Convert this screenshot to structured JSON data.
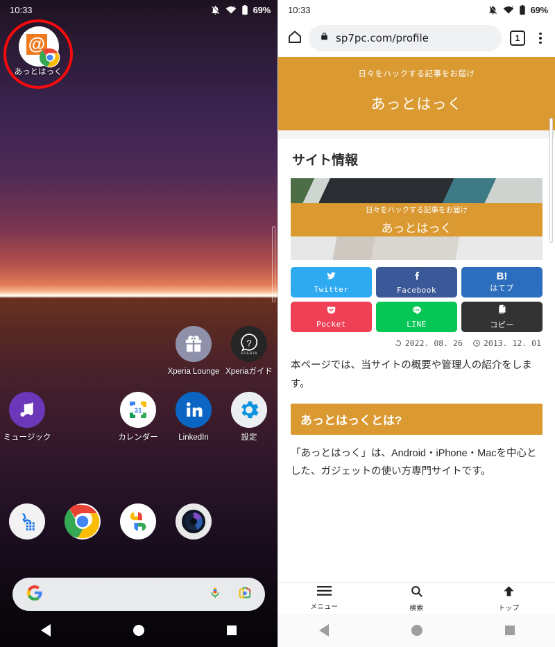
{
  "left": {
    "status": {
      "time": "10:33",
      "battery": "69%",
      "icons": [
        "notifications-off-icon",
        "wifi-icon",
        "battery-icon"
      ]
    },
    "shortcut": {
      "label": "あっとはっく",
      "icon_glyph": "@",
      "badge": "chrome-badge",
      "highlight_color": "#f40b0b"
    },
    "apps": [
      [
        {
          "label": "",
          "icon": "empty",
          "empty": true
        },
        {
          "label": "",
          "icon": "empty",
          "empty": true
        },
        {
          "label": "",
          "icon": "empty",
          "empty": true
        },
        {
          "label": "Xperia Lounge",
          "icon": "gift-icon"
        },
        {
          "label": "Xperiaガイド",
          "icon": "question-mark-icon"
        }
      ],
      [
        {
          "label": "ミュージック",
          "icon": "music-note-icon"
        },
        {
          "label": "",
          "icon": "empty",
          "empty": true
        },
        {
          "label": "カレンダー",
          "icon": "calendar-icon"
        },
        {
          "label": "LinkedIn",
          "icon": "linkedin-icon"
        },
        {
          "label": "設定",
          "icon": "gear-icon"
        }
      ]
    ],
    "dock": [
      {
        "label": "",
        "icon": "phone-icon"
      },
      {
        "label": "",
        "icon": "chrome-icon"
      },
      {
        "label": "",
        "icon": "google-photos-icon"
      },
      {
        "label": "",
        "icon": "camera-icon"
      }
    ],
    "search": {
      "logo": "google-g-icon",
      "mic": "microphone-icon",
      "lens": "google-lens-icon",
      "placeholder": ""
    },
    "navbar": {
      "back": "back-triangle-icon",
      "home": "home-circle-icon",
      "recents": "recents-square-icon"
    }
  },
  "right": {
    "status": {
      "time": "10:33",
      "battery": "69%"
    },
    "toolbar": {
      "home_icon": "home-icon",
      "lock_icon": "lock-icon",
      "url": "sp7pc.com/profile",
      "tab_count": "1",
      "menu_icon": "kebab-menu-icon"
    },
    "hero": {
      "tagline": "日々をハックする記事をお届け",
      "site_name": "あっとはっく",
      "bg": "#da9931"
    },
    "heading": "サイト情報",
    "eyecatch": {
      "tagline": "日々をハックする記事をお届け",
      "title": "あっとはっく"
    },
    "share_buttons": [
      {
        "label": "Twitter",
        "icon": "twitter-bird-icon",
        "color": "#2eaaf1"
      },
      {
        "label": "Facebook",
        "icon": "facebook-f-icon",
        "color": "#3b5998"
      },
      {
        "label": "はてプ",
        "icon": "hatena-b-icon",
        "color": "#2c6ebd"
      },
      {
        "label": "Pocket",
        "icon": "pocket-icon",
        "color": "#ef4056"
      },
      {
        "label": "LINE",
        "icon": "line-icon",
        "color": "#06c755"
      },
      {
        "label": "コピー",
        "icon": "copy-icon",
        "color": "#333333"
      }
    ],
    "dates": {
      "updated": "2022. 08. 26",
      "published": "2013. 12. 01",
      "updated_icon": "history-icon",
      "published_icon": "clock-icon"
    },
    "paragraph": "本ページでは、当サイトの概要や管理人の紹介をします。",
    "subheading": "あっとはっくとは?",
    "paragraph2": "「あっとはっく」は、Android・iPhone・Macを中心とした、ガジェットの使い方専門サイトです。",
    "site_nav": [
      {
        "label": "メニュー",
        "icon": "hamburger-icon"
      },
      {
        "label": "検索",
        "icon": "search-icon"
      },
      {
        "label": "トップ",
        "icon": "arrow-up-icon"
      }
    ],
    "navbar": {
      "back": "back-triangle-icon",
      "home": "home-circle-icon",
      "recents": "recents-square-icon"
    }
  }
}
